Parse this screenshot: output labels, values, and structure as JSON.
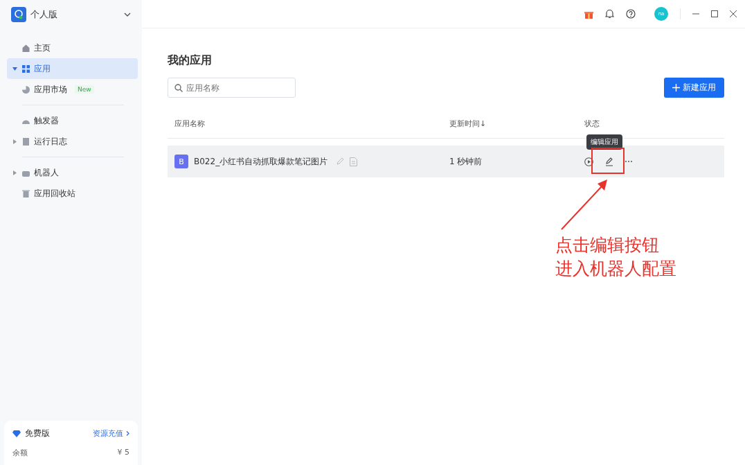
{
  "sidebar": {
    "workspace": "个人版",
    "sections": [
      [
        {
          "label": "主页",
          "kind": "link",
          "selected": false
        },
        {
          "label": "应用",
          "kind": "group",
          "expanded": true,
          "selected": true
        },
        {
          "label": "应用市场",
          "kind": "link",
          "selected": false,
          "badge": "New"
        }
      ],
      [
        {
          "label": "触发器",
          "kind": "link",
          "selected": false
        },
        {
          "label": "运行日志",
          "kind": "group",
          "expanded": false,
          "selected": false
        }
      ],
      [
        {
          "label": "机器人",
          "kind": "group",
          "expanded": false,
          "selected": false
        },
        {
          "label": "应用回收站",
          "kind": "link",
          "selected": false
        }
      ]
    ],
    "plan": {
      "name": "免费版",
      "link": "资源充值",
      "balance_label": "余额",
      "balance": "¥ 5"
    }
  },
  "topbar": {
    "avatar": "na"
  },
  "page": {
    "title": "我的应用",
    "search": {
      "placeholder": "应用名称"
    },
    "new_button": "新建应用"
  },
  "table": {
    "columns": [
      {
        "label": "应用名称"
      },
      {
        "label": "更新时间",
        "sort": "↓"
      },
      {
        "label": "状态"
      }
    ],
    "rows": [
      {
        "badge": "B",
        "name": "B022_小红书自动抓取爆款笔记图片",
        "updated": "1 秒钟前",
        "tooltip": "编辑应用"
      }
    ]
  },
  "annotation": {
    "lines": [
      "点击编辑按钮",
      "进入机器人配置"
    ]
  }
}
